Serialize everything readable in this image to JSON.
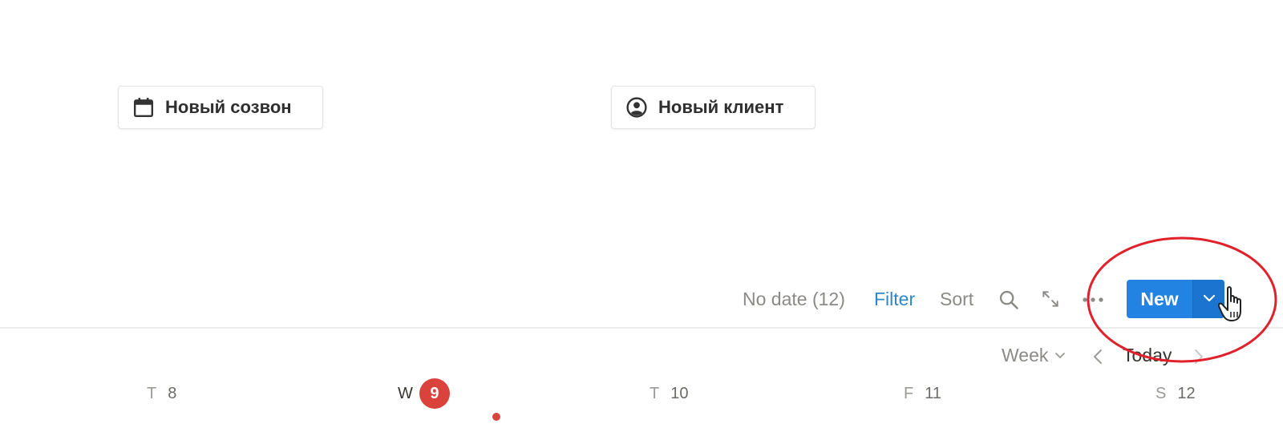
{
  "template_buttons": [
    {
      "label": "Новый созвон",
      "icon": "calendar-icon"
    },
    {
      "label": "Новый клиент",
      "icon": "user-circle-icon"
    }
  ],
  "toolbar": {
    "no_date": "No date (12)",
    "filter": "Filter",
    "sort": "Sort",
    "search_icon": "search-icon",
    "expand_icon": "expand-icon",
    "more_icon": "more-icon",
    "new_label": "New",
    "new_dropdown_icon": "chevron-down-icon"
  },
  "calendar_nav": {
    "view": "Week",
    "today": "Today"
  },
  "days": [
    {
      "dow": "T",
      "num": "8",
      "today": false
    },
    {
      "dow": "W",
      "num": "9",
      "today": true
    },
    {
      "dow": "T",
      "num": "10",
      "today": false
    },
    {
      "dow": "F",
      "num": "11",
      "today": false
    },
    {
      "dow": "S",
      "num": "12",
      "today": false
    }
  ],
  "colors": {
    "accent_blue": "#2383e2",
    "filter_blue": "#2e87c9",
    "today_red": "#d9433b",
    "annotation_red": "#e0202a",
    "muted_text": "#8b8a86"
  }
}
